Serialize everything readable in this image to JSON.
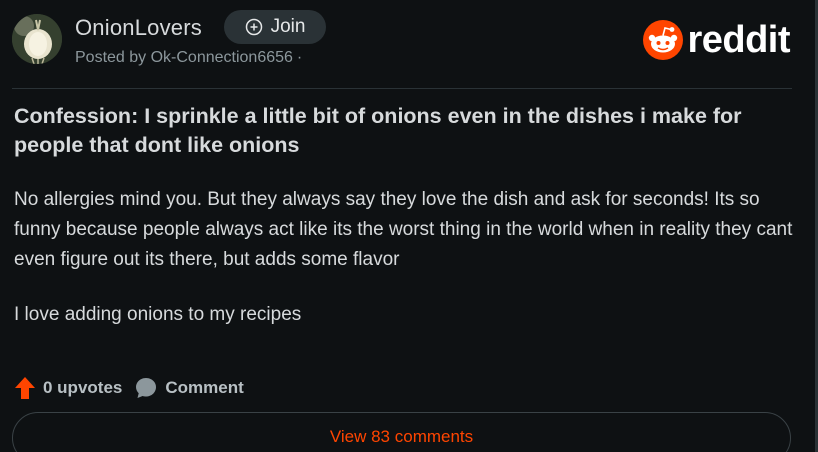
{
  "post": {
    "subreddit": "OnionLovers",
    "join_label": "Join",
    "posted_by": "Posted by Ok-Connection6656",
    "posted_by_sep": "·",
    "title": "Confession: I sprinkle a little bit of onions even in the dishes i make for people that dont like onions",
    "body": [
      "No allergies mind you. But they always say they love the dish and ask for seconds! Its so funny because people always act like its the worst thing in the world when in reality they cant even figure out its there, but adds some flavor",
      "I love adding onions to my recipes"
    ],
    "upvotes": "0 upvotes",
    "comment_label": "Comment",
    "view_comments": "View 83 comments"
  },
  "brand": {
    "wordmark": "reddit",
    "accent": "#ff4500"
  },
  "icons": {
    "avatar": "onion-avatar",
    "join": "plus-circle-icon",
    "logo": "reddit-snoo-icon",
    "upvote": "upvote-arrow-icon",
    "comment": "comment-bubble-icon"
  }
}
